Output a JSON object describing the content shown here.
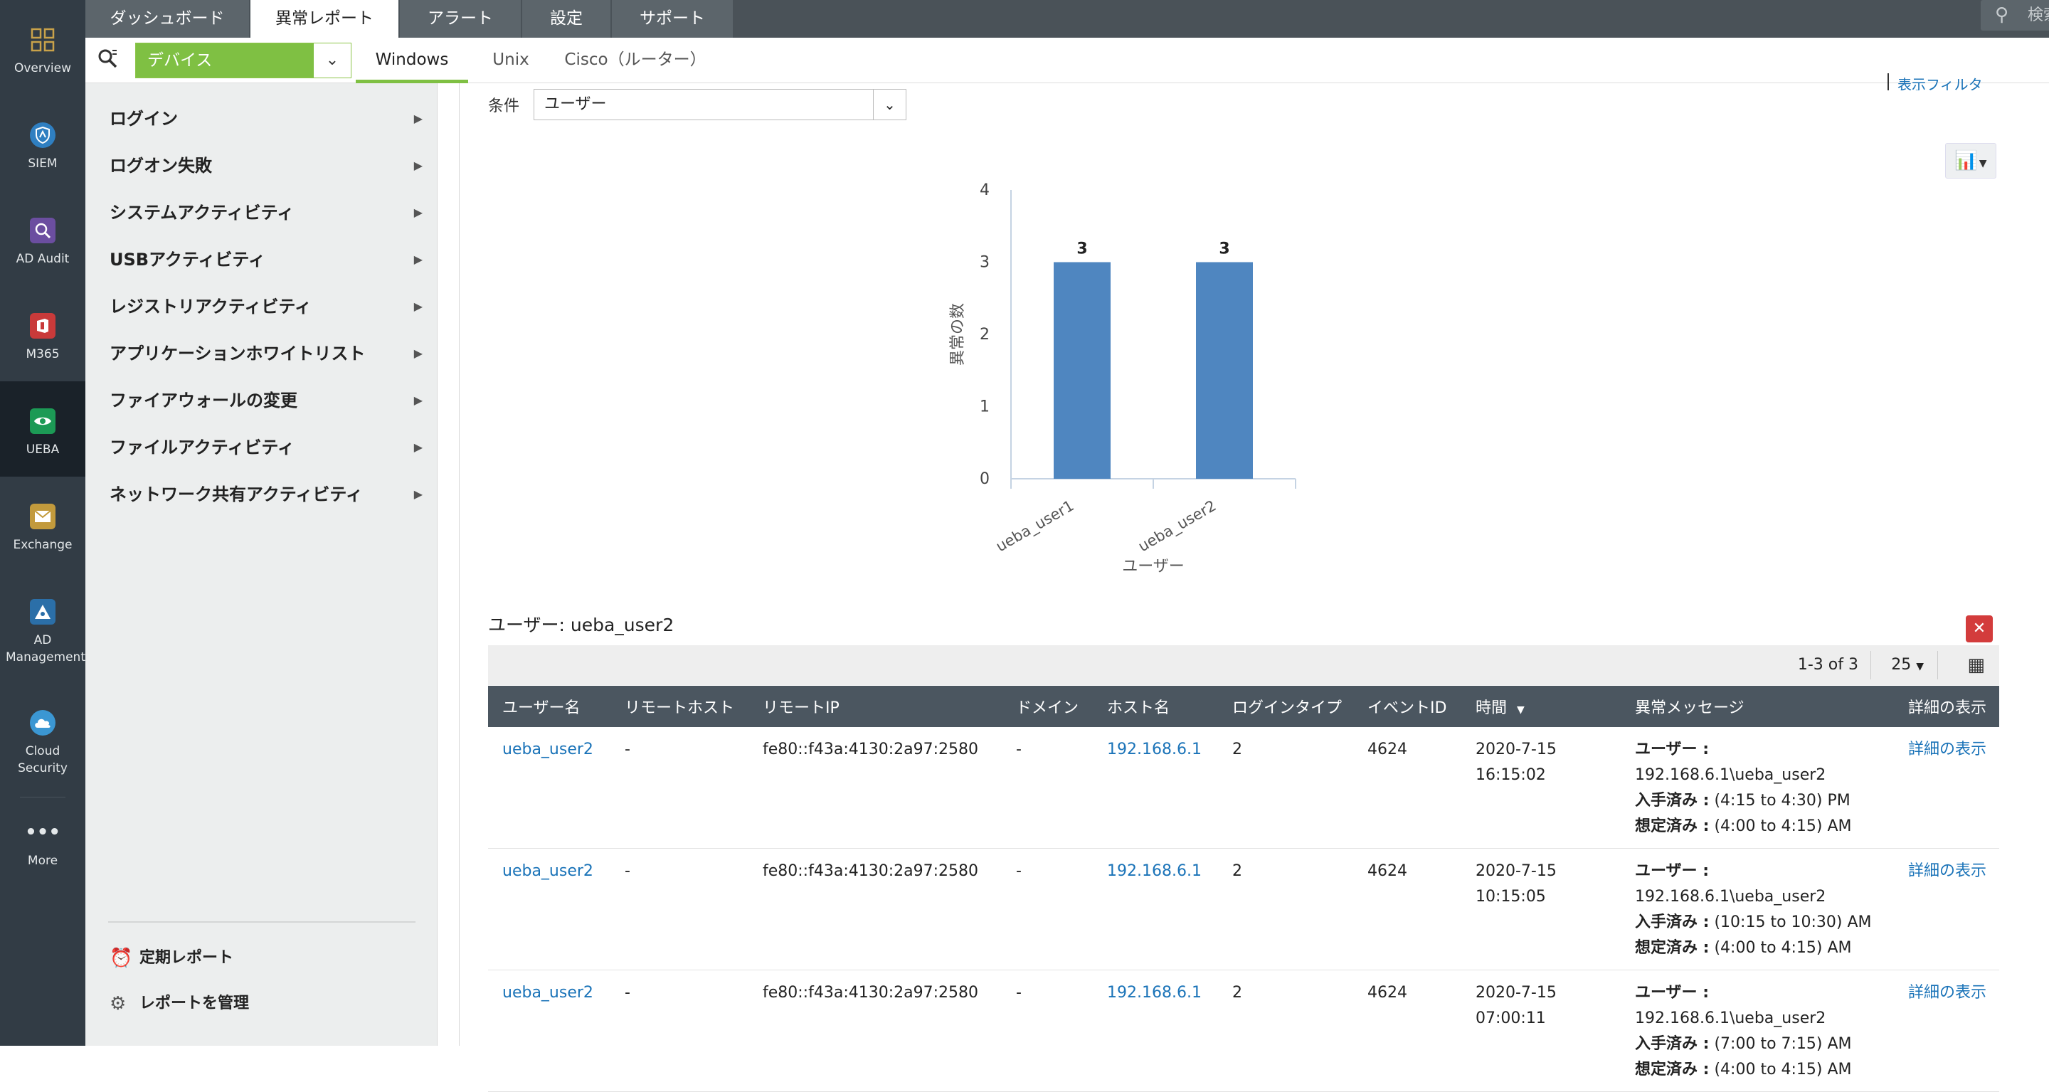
{
  "rail": [
    {
      "label": "Overview",
      "icon": "grid-icon"
    },
    {
      "label": "SIEM",
      "icon": "siem-shield-icon"
    },
    {
      "label": "AD Audit",
      "icon": "ad-audit-icon"
    },
    {
      "label": "M365",
      "icon": "m365-icon"
    },
    {
      "label": "UEBA",
      "icon": "ueba-eye-icon",
      "active": true
    },
    {
      "label": "Exchange",
      "icon": "exchange-mail-icon"
    },
    {
      "label": "AD Management",
      "icon": "ad-management-icon"
    },
    {
      "label": "Cloud Security",
      "icon": "cloud-security-icon"
    },
    {
      "label": "More",
      "icon": "more-dots-icon"
    }
  ],
  "top_tabs": [
    "ダッシュボード",
    "異常レポート",
    "アラート",
    "設定",
    "サポート"
  ],
  "search_placeholder": "検索...",
  "device_select": "デバイス",
  "os_tabs": [
    "Windows",
    "Unix",
    "Cisco（ルーター）"
  ],
  "menu": [
    "ログイン",
    "ログオン失敗",
    "システムアクティビティ",
    "USBアクティビティ",
    "レジストリアクティビティ",
    "アプリケーションホワイトリスト",
    "ファイアウォールの変更",
    "ファイルアクティビティ",
    "ネットワーク共有アクティビティ"
  ],
  "bottom_links": {
    "scheduled": "定期レポート",
    "manage": "レポートを管理"
  },
  "condition_label": "条件",
  "condition_value": "ユーザー",
  "top_link": "表示フィルタ",
  "chart_data": {
    "type": "bar",
    "categories": [
      "ueba_user1",
      "ueba_user2"
    ],
    "values": [
      3,
      3
    ],
    "data_labels": [
      "3",
      "3"
    ],
    "xlabel": "ユーザー",
    "ylabel": "異常の数",
    "ylim": [
      0,
      4
    ],
    "yticks": [
      0,
      1,
      2,
      3,
      4
    ],
    "bar_color": "#4f86c0",
    "grid": false
  },
  "selected_user_title": "ユーザー: ueba_user2",
  "pager": {
    "count": "1-3 of 3",
    "per_page": "25"
  },
  "columns": [
    "ユーザー名",
    "リモートホスト",
    "リモートIP",
    "ドメイン",
    "ホスト名",
    "ログインタイプ",
    "イベントID",
    "時間",
    "異常メッセージ",
    "詳細の表示"
  ],
  "rows": [
    {
      "user": "ueba_user2",
      "remote_host": "-",
      "remote_ip": "fe80::f43a:4130:2a97:2580",
      "domain": "-",
      "host": "192.168.6.1",
      "login_type": "2",
      "event_id": "4624",
      "date": "2020-7-15",
      "time": "16:15:02",
      "msg_user_label": "ユーザー :",
      "msg_user": "192.168.6.1\\ueba_user2",
      "msg_got_label": "入手済み :",
      "msg_got": "(4:15 to 4:30) PM",
      "msg_exp_label": "想定済み :",
      "msg_exp": "(4:00 to 4:15) AM",
      "detail": "詳細の表示"
    },
    {
      "user": "ueba_user2",
      "remote_host": "-",
      "remote_ip": "fe80::f43a:4130:2a97:2580",
      "domain": "-",
      "host": "192.168.6.1",
      "login_type": "2",
      "event_id": "4624",
      "date": "2020-7-15",
      "time": "10:15:05",
      "msg_user_label": "ユーザー :",
      "msg_user": "192.168.6.1\\ueba_user2",
      "msg_got_label": "入手済み :",
      "msg_got": "(10:15 to 10:30) AM",
      "msg_exp_label": "想定済み :",
      "msg_exp": "(4:00 to 4:15) AM",
      "detail": "詳細の表示"
    },
    {
      "user": "ueba_user2",
      "remote_host": "-",
      "remote_ip": "fe80::f43a:4130:2a97:2580",
      "domain": "-",
      "host": "192.168.6.1",
      "login_type": "2",
      "event_id": "4624",
      "date": "2020-7-15",
      "time": "07:00:11",
      "msg_user_label": "ユーザー :",
      "msg_user": "192.168.6.1\\ueba_user2",
      "msg_got_label": "入手済み :",
      "msg_got": "(7:00 to 7:15) AM",
      "msg_exp_label": "想定済み :",
      "msg_exp": "(4:00 to 4:15) AM",
      "detail": "詳細の表示"
    }
  ]
}
